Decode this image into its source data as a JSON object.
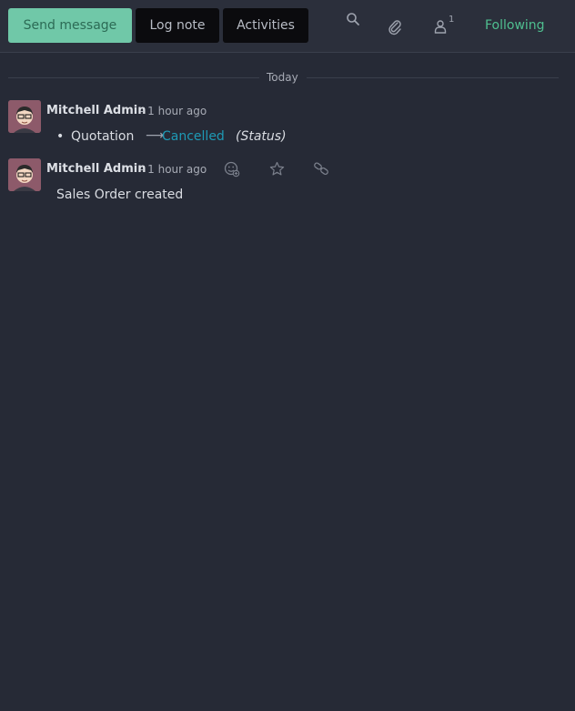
{
  "toolbar": {
    "send_message": "Send message",
    "log_note": "Log note",
    "activities": "Activities",
    "followers_count": "1",
    "following": "Following"
  },
  "thread": {
    "separator": "Today",
    "messages": [
      {
        "author": "Mitchell Admin",
        "time": "- 1 hour ago",
        "tracking": {
          "old_value": "Quotation",
          "new_value": "Cancelled",
          "field": "(Status)"
        }
      },
      {
        "author": "Mitchell Admin",
        "time": "- 1 hour ago",
        "body": "Sales Order created"
      }
    ]
  },
  "icons": {
    "search": "search-icon",
    "attachment": "paperclip-icon",
    "followers": "user-icon",
    "reaction": "smiley-add-icon",
    "star": "star-icon",
    "link": "link-icon"
  },
  "colors": {
    "background": "#262a36",
    "send_button": "#70c8a8",
    "following": "#4fbf90",
    "new_value": "#1e9ab5"
  }
}
